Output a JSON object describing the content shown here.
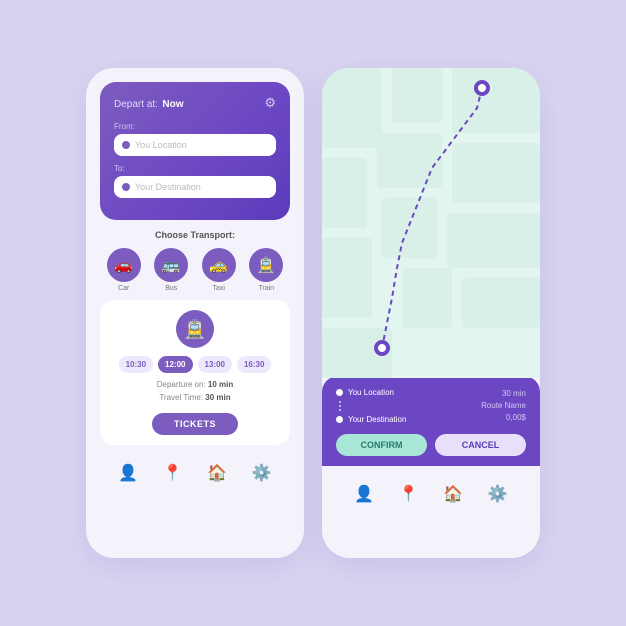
{
  "leftPhone": {
    "header": {
      "departLabel": "Depart at:",
      "departValue": "Now",
      "fromLabel": "From:",
      "fromPlaceholder": "You Location",
      "toLabel": "To:",
      "toPlaceholder": "Your Destination"
    },
    "transport": {
      "title": "Choose Transport:",
      "options": [
        "Car",
        "Bus",
        "Taxi",
        "Train"
      ]
    },
    "schedule": {
      "times": [
        "10:30",
        "12:00",
        "13:00",
        "16:30"
      ],
      "activeTime": "12:00",
      "departureLabel": "Departure on:",
      "departureValue": "10 min",
      "travelLabel": "Travel Time:",
      "travelValue": "30 min",
      "ticketsBtn": "TICKETS"
    },
    "nav": [
      "👤",
      "📍",
      "🏠",
      "⚙️"
    ]
  },
  "rightPhone": {
    "route": {
      "fromLabel": "You Location",
      "toLabel": "Your Destination",
      "duration": "30 min",
      "routeName": "Route Name",
      "price": "0,00$"
    },
    "buttons": {
      "confirm": "CONFIRM",
      "cancel": "CANCEL"
    },
    "nav": [
      "👤",
      "📍",
      "🏠",
      "⚙️"
    ]
  }
}
